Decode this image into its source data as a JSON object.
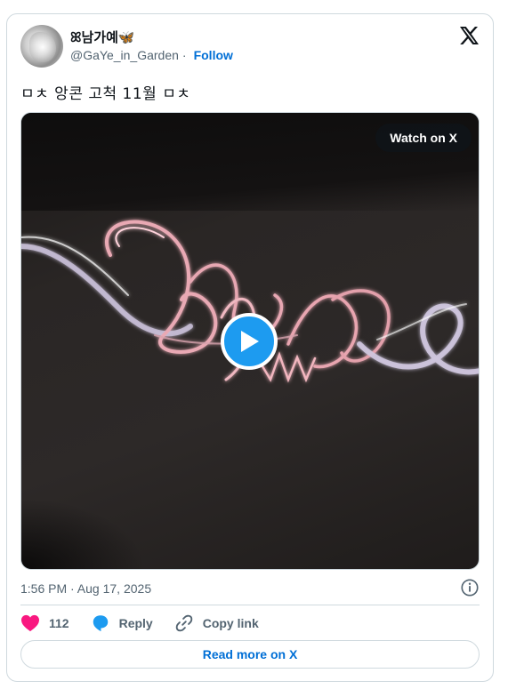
{
  "author": {
    "name": "ꕤ남가예🦋",
    "handle": "@GaYe_in_Garden",
    "separator": "·",
    "follow_label": "Follow"
  },
  "tweet": {
    "text": "ㅁㅊ 앙콘 고척 11월 ㅁㅊ",
    "timestamp": "1:56 PM · Aug 17, 2025"
  },
  "media": {
    "watch_label": "Watch on X",
    "play_icon": "play-icon"
  },
  "actions": {
    "like_count": "112",
    "reply_label": "Reply",
    "copy_label": "Copy link"
  },
  "footer": {
    "read_more_label": "Read more on X"
  },
  "colors": {
    "accent": "#1d9bf0",
    "link": "#006fd6",
    "like": "#f91880",
    "muted": "#536471",
    "border": "#cfd9de"
  }
}
